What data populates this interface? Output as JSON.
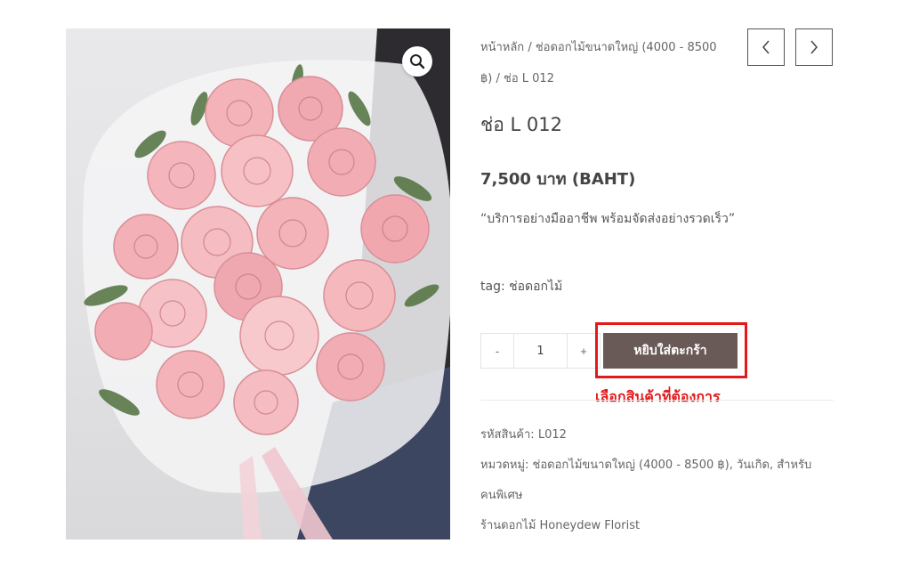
{
  "breadcrumb": {
    "home": "หน้าหลัก",
    "separator": "/",
    "category": "ช่อดอกไม้ขนาดใหญ่ (4000 - 8500 ฿)",
    "current": "ช่อ L 012"
  },
  "product": {
    "title": "ช่อ L 012",
    "price": "7,500 บาท (BAHT)",
    "description": "“บริการอย่างมืออาชีพ พร้อมจัดส่งอย่างรวดเร็ว”",
    "tag": "tag: ช่อดอกไม้"
  },
  "cart": {
    "minus": "-",
    "quantity": "1",
    "plus": "+",
    "add_label": "หยิบใส่ตะกร้า"
  },
  "annotation": {
    "note": "เลือกสินค้าที่ต้องการ",
    "color": "#e11b1b"
  },
  "meta": {
    "sku_label": "รหัสสินค้า:",
    "sku": "L012",
    "category_label": "หมวดหมู่:",
    "category_1": "ช่อดอกไม้ขนาดใหญ่ (4000 - 8500 ฿)",
    "category_2": "วันเกิด",
    "category_3": "สำหรับคนพิเศษ",
    "shop": "ร้านดอกไม้ Honeydew Florist"
  },
  "icons": {
    "zoom": "magnifier-icon",
    "prev": "chevron-left-icon",
    "next": "chevron-right-icon"
  },
  "colors": {
    "button": "#6a5a57",
    "highlight": "#e11b1b"
  }
}
